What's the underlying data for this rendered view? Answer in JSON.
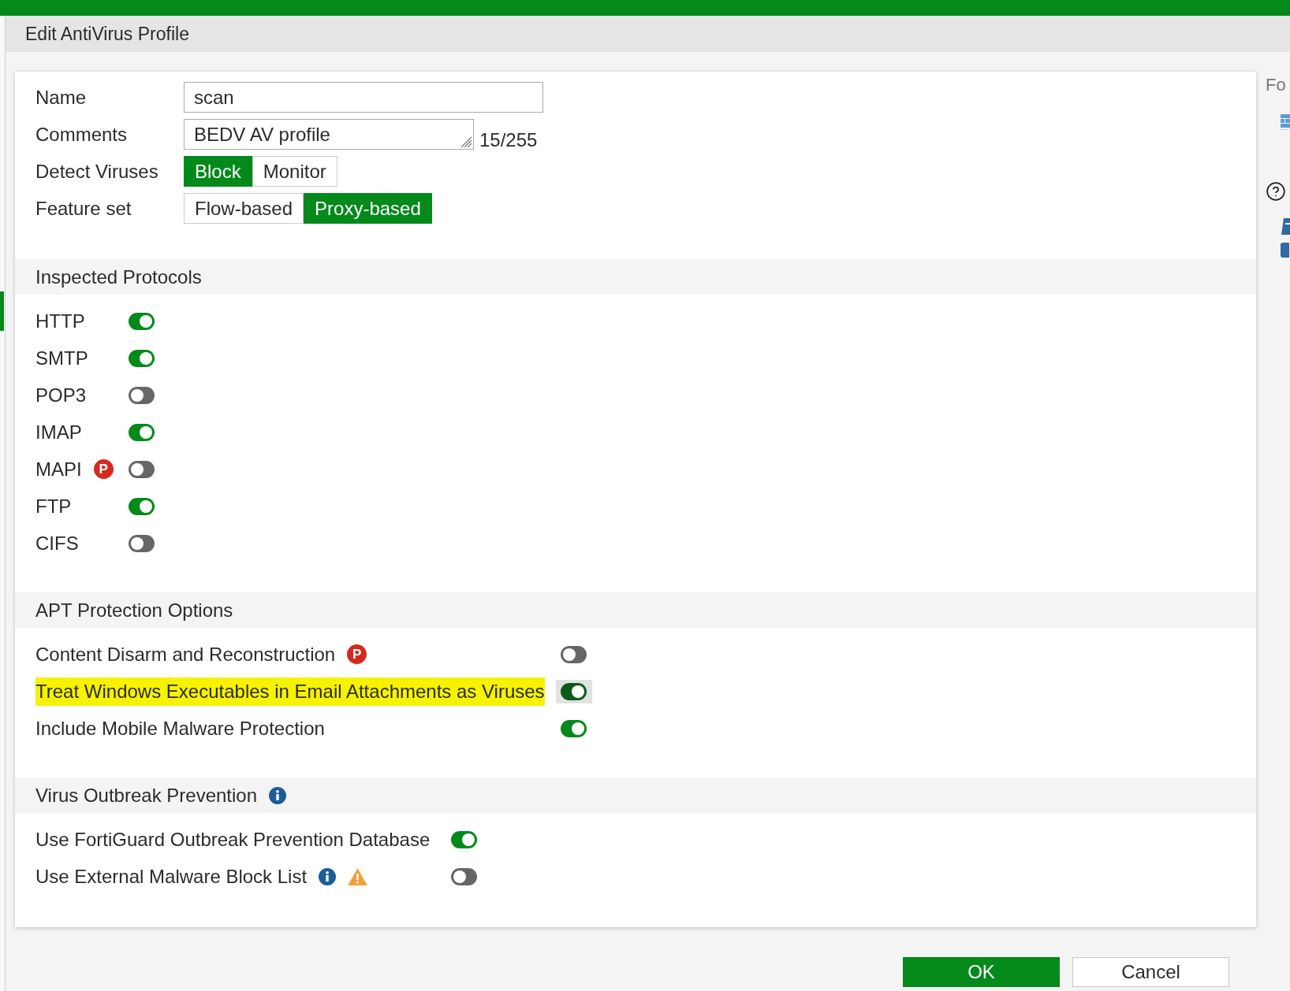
{
  "dialog": {
    "title": "Edit AntiVirus Profile"
  },
  "form": {
    "name": {
      "label": "Name",
      "value": "scan"
    },
    "comments": {
      "label": "Comments",
      "value": "BEDV AV profile",
      "counter": "15/255"
    },
    "detect_viruses": {
      "label": "Detect Viruses",
      "options": [
        {
          "label": "Block",
          "selected": true
        },
        {
          "label": "Monitor",
          "selected": false
        }
      ]
    },
    "feature_set": {
      "label": "Feature set",
      "options": [
        {
          "label": "Flow-based",
          "selected": false
        },
        {
          "label": "Proxy-based",
          "selected": true
        }
      ]
    }
  },
  "sections": [
    {
      "title": "Inspected Protocols",
      "kind": "protocols",
      "info": false,
      "items": [
        {
          "label": "HTTP",
          "on": true
        },
        {
          "label": "SMTP",
          "on": true
        },
        {
          "label": "POP3",
          "on": false
        },
        {
          "label": "IMAP",
          "on": true
        },
        {
          "label": "MAPI",
          "badge": "P",
          "on": false
        },
        {
          "label": "FTP",
          "on": true
        },
        {
          "label": "CIFS",
          "on": false
        }
      ]
    },
    {
      "title": "APT Protection Options",
      "kind": "options",
      "info": false,
      "items": [
        {
          "label": "Content Disarm and Reconstruction",
          "badge": "P",
          "on": false,
          "highlighted": false
        },
        {
          "label": "Treat Windows Executables in Email Attachments as Viruses",
          "on": true,
          "highlighted": true
        },
        {
          "label": "Include Mobile Malware Protection",
          "on": true,
          "highlighted": false
        }
      ]
    },
    {
      "title": "Virus Outbreak Prevention",
      "kind": "outbreak",
      "info": true,
      "items": [
        {
          "label": "Use FortiGuard Outbreak Prevention Database",
          "on": true,
          "info": false,
          "warning": false
        },
        {
          "label": "Use External Malware Block List",
          "on": false,
          "info": true,
          "warning": true
        }
      ]
    }
  ],
  "buttons": [
    {
      "label": "OK",
      "kind": "primary"
    },
    {
      "label": "Cancel",
      "kind": "secondary"
    }
  ],
  "side_panel": {
    "title": "Fo"
  }
}
